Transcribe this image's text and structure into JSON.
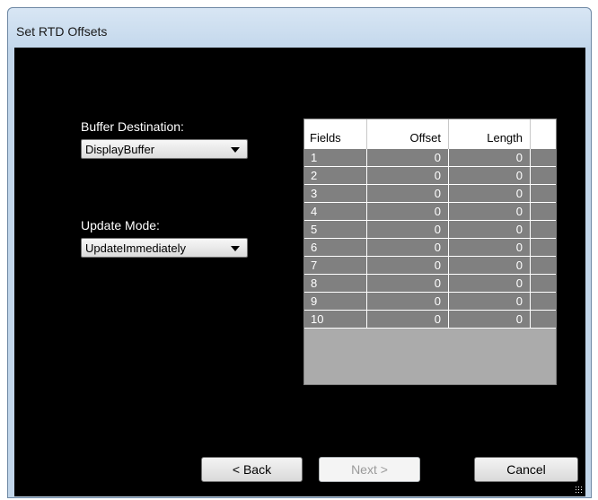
{
  "window": {
    "title": "Set RTD Offsets"
  },
  "buffer": {
    "label": "Buffer Destination:",
    "value": "DisplayBuffer"
  },
  "update": {
    "label": "Update Mode:",
    "value": "UpdateImmediately"
  },
  "table": {
    "headers": [
      "Fields",
      "Offset",
      "Length"
    ],
    "rows": [
      {
        "field": "1",
        "offset": "0",
        "length": "0"
      },
      {
        "field": "2",
        "offset": "0",
        "length": "0"
      },
      {
        "field": "3",
        "offset": "0",
        "length": "0"
      },
      {
        "field": "4",
        "offset": "0",
        "length": "0"
      },
      {
        "field": "5",
        "offset": "0",
        "length": "0"
      },
      {
        "field": "6",
        "offset": "0",
        "length": "0"
      },
      {
        "field": "7",
        "offset": "0",
        "length": "0"
      },
      {
        "field": "8",
        "offset": "0",
        "length": "0"
      },
      {
        "field": "9",
        "offset": "0",
        "length": "0"
      },
      {
        "field": "10",
        "offset": "0",
        "length": "0"
      }
    ]
  },
  "buttons": {
    "back": "< Back",
    "next": "Next >",
    "cancel": "Cancel"
  }
}
